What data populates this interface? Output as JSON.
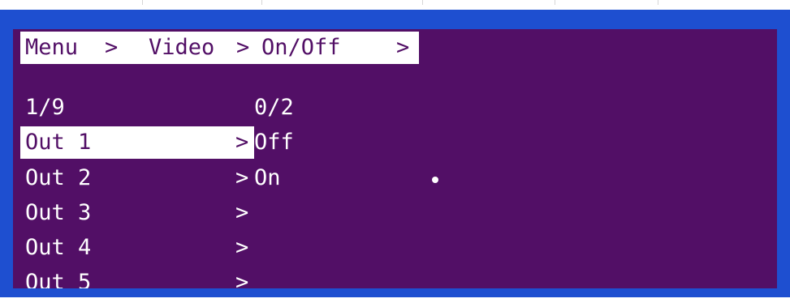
{
  "breadcrumb": {
    "menu": "Menu",
    "sep1": ">",
    "video": "Video",
    "sep2": ">",
    "onoff": "On/Off",
    "sep3": ">"
  },
  "left_list": {
    "counter": "1/9",
    "items": [
      {
        "label": "Out 1",
        "arrow": ">"
      },
      {
        "label": "Out 2",
        "arrow": ">"
      },
      {
        "label": "Out 3",
        "arrow": ">"
      },
      {
        "label": "Out 4",
        "arrow": ">"
      },
      {
        "label": "Out 5",
        "arrow": ">"
      }
    ]
  },
  "right_list": {
    "counter": "0/2",
    "options": [
      "Off",
      "On"
    ]
  },
  "colors": {
    "frame": "#1e4fd0",
    "screen": "#520f66",
    "highlight": "#ffffff"
  }
}
